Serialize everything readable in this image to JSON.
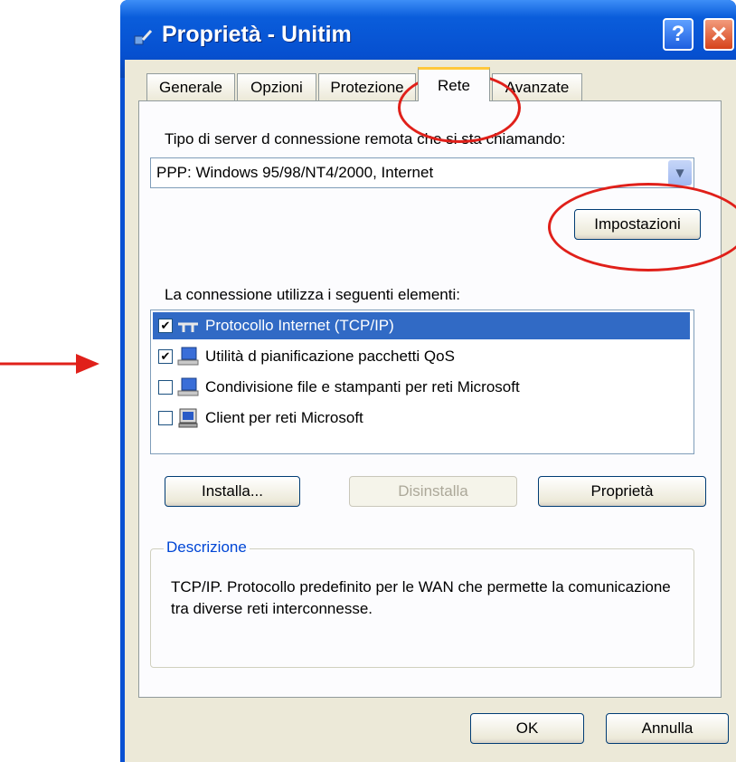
{
  "window": {
    "title": "Proprietà - Unitim",
    "help_glyph": "?",
    "close_glyph": "✕"
  },
  "tabs": [
    {
      "label": "Generale"
    },
    {
      "label": "Opzioni"
    },
    {
      "label": "Protezione"
    },
    {
      "label": "Rete",
      "active": true
    },
    {
      "label": "Avanzate"
    }
  ],
  "server_type": {
    "label": "Tipo di server d connessione remota che si sta chiamando:",
    "value": "PPP: Windows 95/98/NT4/2000, Internet",
    "settings_button": "Impostazioni"
  },
  "components": {
    "label": "La connessione utilizza i seguenti elementi:",
    "items": [
      {
        "label": "Protocollo Internet (TCP/IP)",
        "checked": true,
        "selected": true,
        "icon": "network-protocol-icon"
      },
      {
        "label": "Utilità d pianificazione pacchetti QoS",
        "checked": true,
        "selected": false,
        "icon": "network-service-icon"
      },
      {
        "label": "Condivisione file e stampanti per reti Microsoft",
        "checked": false,
        "selected": false,
        "icon": "network-service-icon"
      },
      {
        "label": "Client per reti Microsoft",
        "checked": false,
        "selected": false,
        "icon": "network-client-icon"
      }
    ]
  },
  "buttons": {
    "install": "Installa...",
    "uninstall": "Disinstalla",
    "properties": "Proprietà",
    "ok": "OK",
    "cancel": "Annulla"
  },
  "description": {
    "title": "Descrizione",
    "text": "TCP/IP. Protocollo predefinito per le WAN che permette la comunicazione tra diverse reti interconnesse."
  },
  "colors": {
    "annotation": "#e0201a",
    "title_bar": "#0a5ddb",
    "selection": "#316ac5"
  }
}
